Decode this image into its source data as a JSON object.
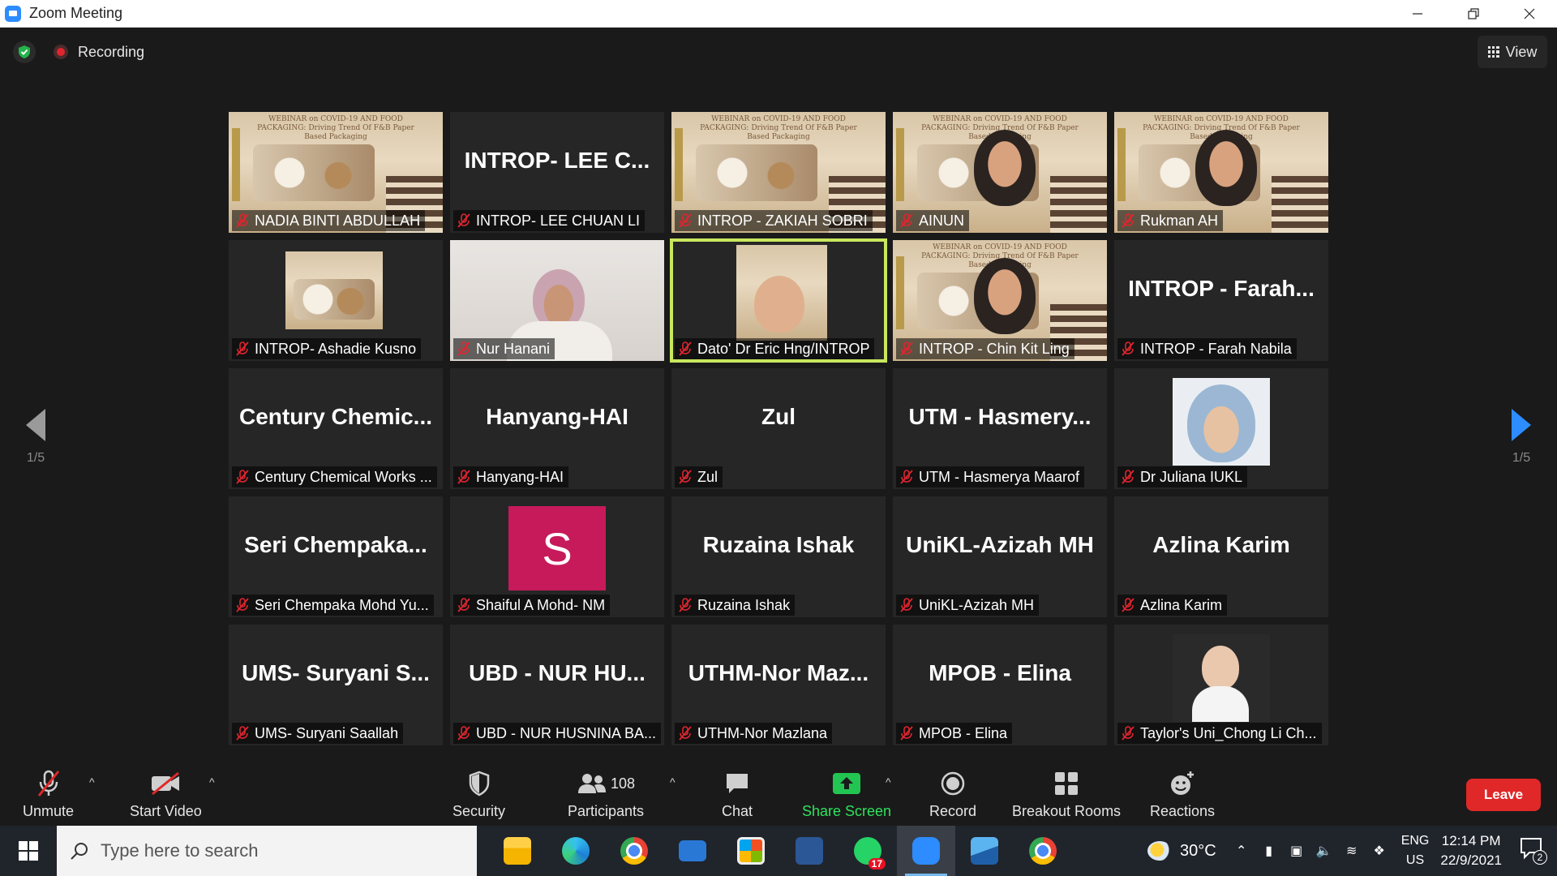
{
  "window": {
    "title": "Zoom Meeting"
  },
  "top": {
    "recording_label": "Recording",
    "view_label": "View"
  },
  "nav": {
    "left_page": "1/5",
    "right_page": "1/5"
  },
  "tiles": [
    {
      "name": "NADIA BINTI ABDULLAH",
      "big": "",
      "kind": "poster"
    },
    {
      "name": "INTROP- LEE CHUAN LI",
      "big": "INTROP-  LEE  C...",
      "kind": "text"
    },
    {
      "name": "INTROP - ZAKIAH SOBRI",
      "big": "",
      "kind": "poster"
    },
    {
      "name": "AINUN",
      "big": "",
      "kind": "poster-face"
    },
    {
      "name": "Rukman AH",
      "big": "",
      "kind": "poster-face"
    },
    {
      "name": "INTROP- Ashadie Kusno",
      "big": "",
      "kind": "poster-small"
    },
    {
      "name": "Nur Hanani",
      "big": "",
      "kind": "video"
    },
    {
      "name": "Dato' Dr Eric Hng/INTROP",
      "big": "",
      "kind": "active-small"
    },
    {
      "name": "INTROP - Chin Kit Ling",
      "big": "",
      "kind": "poster-face"
    },
    {
      "name": "INTROP - Farah Nabila",
      "big": "INTROP  -  Farah...",
      "kind": "text"
    },
    {
      "name": "Century Chemical Works ...",
      "big": "Century  Chemic...",
      "kind": "text"
    },
    {
      "name": "Hanyang-HAI",
      "big": "Hanyang-HAI",
      "kind": "text"
    },
    {
      "name": "Zul",
      "big": "Zul",
      "kind": "text"
    },
    {
      "name": "UTM - Hasmerya Maarof",
      "big": "UTM  -  Hasmery...",
      "kind": "text"
    },
    {
      "name": "Dr Juliana IUKL",
      "big": "",
      "kind": "photo"
    },
    {
      "name": "Seri Chempaka Mohd Yu...",
      "big": "Seri  Chempaka...",
      "kind": "text"
    },
    {
      "name": "Shaiful A Mohd- NM",
      "big": "S",
      "kind": "letter"
    },
    {
      "name": "Ruzaina Ishak",
      "big": "Ruzaina Ishak",
      "kind": "text"
    },
    {
      "name": "UniKL-Azizah MH",
      "big": "UniKL-Azizah MH",
      "kind": "text"
    },
    {
      "name": "Azlina Karim",
      "big": "Azlina Karim",
      "kind": "text"
    },
    {
      "name": "UMS- Suryani Saallah",
      "big": "UMS-  Suryani  S...",
      "kind": "text"
    },
    {
      "name": "UBD - NUR HUSNINA BA...",
      "big": "UBD  -  NUR  HU...",
      "kind": "text"
    },
    {
      "name": "UTHM-Nor Mazlana",
      "big": "UTHM-Nor  Maz...",
      "kind": "text"
    },
    {
      "name": "MPOB - Elina",
      "big": "MPOB - Elina",
      "kind": "text"
    },
    {
      "name": "Taylor's Uni_Chong Li Ch...",
      "big": "",
      "kind": "photo2"
    }
  ],
  "poster_text": "WEBINAR on COVID-19 AND FOOD PACKAGING: Driving Trend Of F&B Paper Based Packaging",
  "toolbar": {
    "unmute": "Unmute",
    "start_video": "Start Video",
    "security": "Security",
    "participants": "Participants",
    "participants_count": "108",
    "chat": "Chat",
    "share_screen": "Share Screen",
    "record": "Record",
    "breakout": "Breakout Rooms",
    "reactions": "Reactions",
    "leave": "Leave"
  },
  "taskbar": {
    "search_placeholder": "Type here to search",
    "whatsapp_badge": "17",
    "temperature": "30°C",
    "lang_1": "ENG",
    "lang_2": "US",
    "time": "12:14 PM",
    "date": "22/9/2021",
    "notifications": "2"
  },
  "colors": {
    "accent": "#2d8cff",
    "active_speaker": "#c8e75d",
    "leave": "#e02828",
    "share": "#2ee35d"
  }
}
